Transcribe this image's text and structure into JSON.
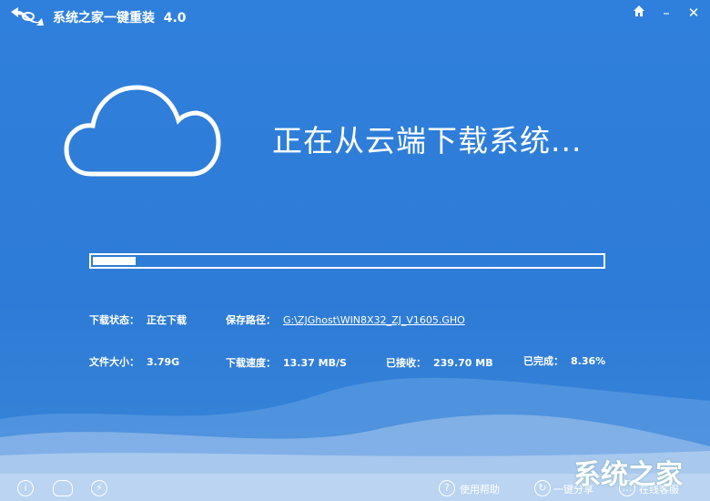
{
  "window": {
    "title": "系统之家一键重装",
    "version": "4.0",
    "buttons": {
      "home": "home-icon",
      "minimize": "–",
      "close": "✕"
    }
  },
  "main": {
    "heading": "正在从云端下载系统...",
    "progress_percent": 8.36
  },
  "info": {
    "status_label": "下载状态：",
    "status_value": "正在下载",
    "path_label": "保存路径：",
    "path_value": "G:\\ZJGhost\\WIN8X32_ZJ_V1605.GHO",
    "size_label": "文件大小：",
    "size_value": "3.79G",
    "speed_label": "下载速度：",
    "speed_value": "13.37 MB/S",
    "received_label": "已接收：",
    "received_value": "239.70 MB",
    "done_label": "已完成：",
    "done_value": "8.36%"
  },
  "footer": {
    "help": "使用帮助",
    "share": "一键分享",
    "service": "在线客服",
    "brand": "系统之家"
  },
  "colors": {
    "background": "#2f80dc",
    "text": "#ffffff"
  }
}
